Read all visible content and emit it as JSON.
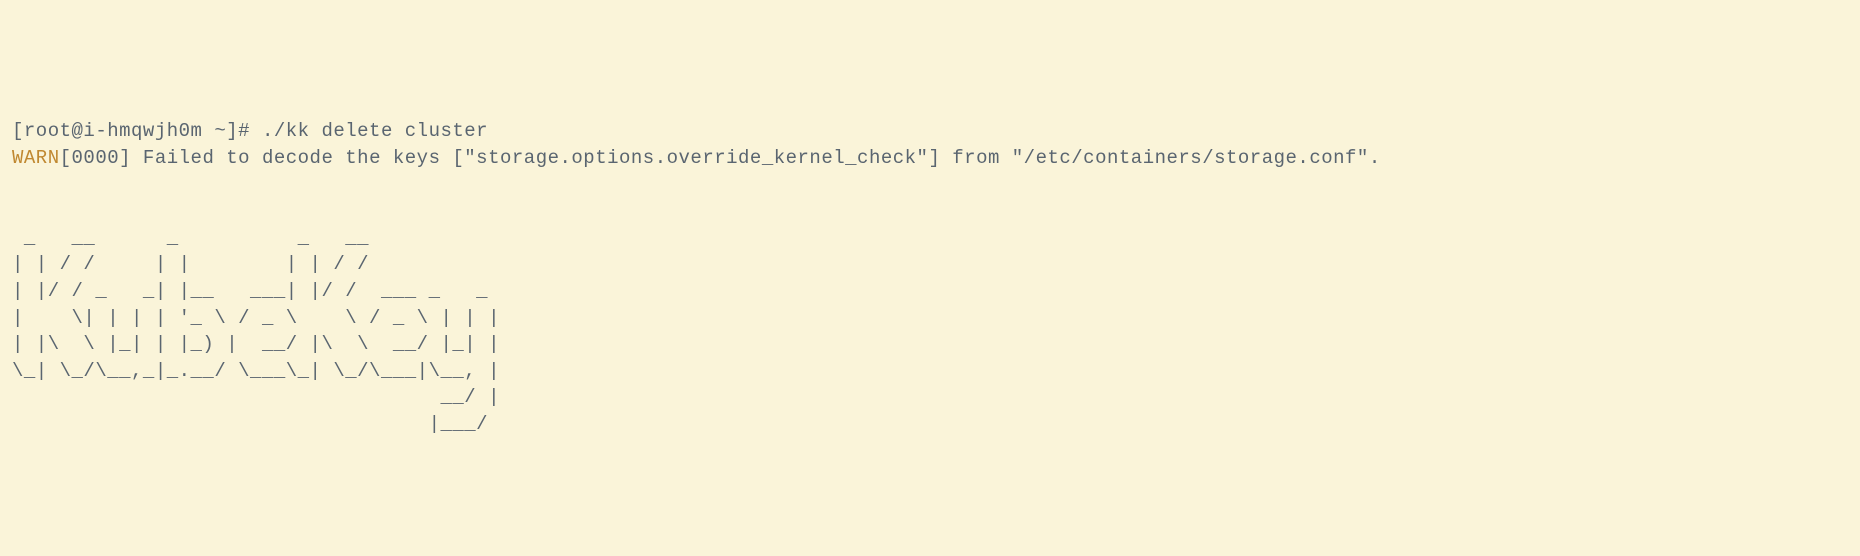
{
  "terminal": {
    "prompt_line": "[root@i-hmqwjh0m ~]# ./kk delete cluster",
    "warn_label": "WARN",
    "warn_bracket": "[0000]",
    "warn_message": " Failed to decode the keys [\"storage.options.override_kernel_check\"] from \"/etc/containers/storage.conf\".",
    "ascii_art": "\n\n _   __      _          _   __           \n| | / /     | |        | | / /           \n| |/ / _   _| |__   ___| |/ /  ___ _   _ \n|    \\| | | | '_ \\ / _ \\    \\ / _ \\ | | |\n| |\\  \\ |_| | |_) |  __/ |\\  \\  __/ |_| |\n\\_| \\_/\\__,_|_.__/ \\___\\_| \\_/\\___|\\__, |\n                                    __/ |\n                                   |___/ "
  }
}
